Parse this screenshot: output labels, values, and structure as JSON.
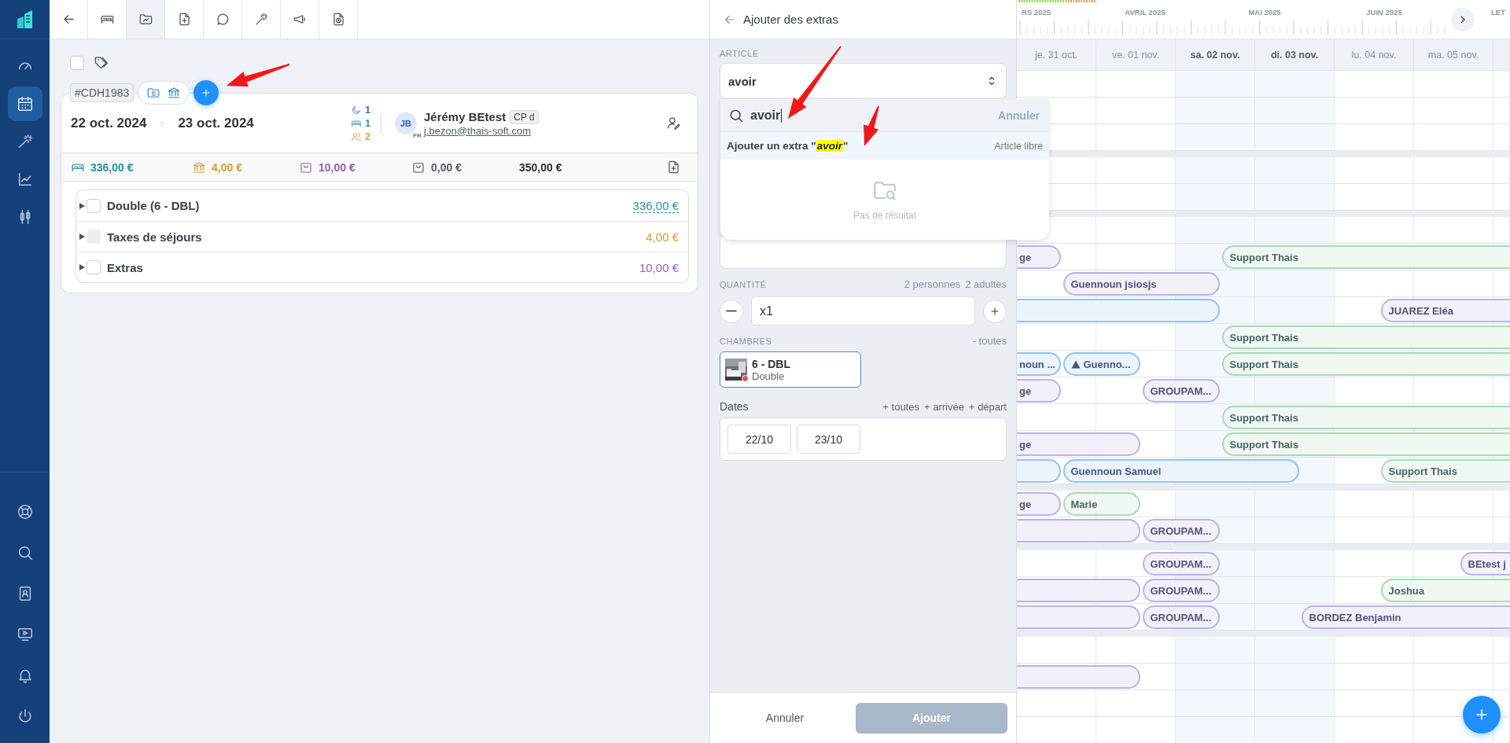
{
  "sidebar": {
    "top": [
      {
        "kind": "gauge",
        "selected": false
      },
      {
        "kind": "calendar",
        "selected": true
      },
      {
        "kind": "wand",
        "selected": false
      },
      {
        "kind": "chart",
        "selected": false
      },
      {
        "kind": "candles",
        "selected": false
      }
    ],
    "bottom": [
      {
        "kind": "lifebuoy",
        "selected": false
      },
      {
        "kind": "search",
        "selected": false
      },
      {
        "kind": "contacts",
        "selected": false
      },
      {
        "kind": "video",
        "selected": false
      },
      {
        "kind": "bell",
        "selected": false
      },
      {
        "kind": "power",
        "selected": false
      }
    ]
  },
  "toolbar": {
    "tabs": [
      {
        "kind": "back",
        "selected": false
      },
      {
        "kind": "bed",
        "selected": false
      },
      {
        "kind": "folder",
        "selected": true
      },
      {
        "kind": "file-plus",
        "selected": false
      },
      {
        "kind": "chat",
        "selected": false
      },
      {
        "kind": "wand",
        "selected": false
      },
      {
        "kind": "megaphone",
        "selected": false
      },
      {
        "kind": "file-clock",
        "selected": false
      }
    ]
  },
  "reservation": {
    "select_all": {
      "checked": false
    },
    "reference": "#CDH1983",
    "arrival": "22 oct. 2024",
    "departure": "23 oct. 2024",
    "counts": [
      {
        "kind": "nights",
        "value": "1"
      },
      {
        "kind": "rooms",
        "value": "1"
      },
      {
        "kind": "guests",
        "value": "2"
      }
    ],
    "guest": {
      "initials": "JB",
      "language": "FR",
      "name": "Jérémy BEtest",
      "badge": "CP d",
      "email": "j.bezon@thais-soft.com"
    },
    "totals": [
      {
        "kind": "room",
        "amount": "336,00 €"
      },
      {
        "kind": "tax",
        "amount": "4,00 €"
      },
      {
        "kind": "extras",
        "amount": "10,00 €"
      },
      {
        "kind": "paid",
        "amount": "0,00 €"
      },
      {
        "kind": "total",
        "amount": "350,00 €"
      }
    ],
    "lines": [
      {
        "kind": "room",
        "label": "Double (6 - DBL)",
        "amount": "336,00 €",
        "checked": false,
        "disabled": false
      },
      {
        "kind": "tax",
        "label": "Taxes de séjours",
        "amount": "4,00 €",
        "checked": false,
        "disabled": true
      },
      {
        "kind": "extras",
        "label": "Extras",
        "amount": "10,00 €",
        "checked": false,
        "disabled": false
      }
    ]
  },
  "extras_panel": {
    "title": "Ajouter des extras",
    "article_label": "ARTICLE",
    "article_value": "avoir",
    "dropdown": {
      "search_value": "avoir",
      "cancel": "Annuler",
      "option": {
        "before": "Ajouter un extra \"",
        "match": "avoir",
        "after": "\"",
        "hint": "Article libre",
        "selected": true
      },
      "empty": "Pas de résultat"
    },
    "quantity_label": "QUANTITÉ",
    "persons": "2 personnes",
    "adults": "2 adultes",
    "quantity": "x1",
    "rooms_label": "CHAMBRES",
    "rooms_all": "- toutes",
    "rooms": [
      {
        "number": "6 - DBL",
        "type": "Double",
        "selected": true,
        "color": "#e05555"
      }
    ],
    "dates_label": "Dates",
    "date_actions": [
      "+ toutes",
      "+ arrivée",
      "+ départ"
    ],
    "dates": [
      "22/10",
      "23/10"
    ],
    "cancel": "Annuler",
    "submit": {
      "label": "Ajouter",
      "disabled": true
    }
  },
  "calendar": {
    "months": [
      "RS 2025",
      "AVRIL 2025",
      "MAI 2025",
      "JUIN 2025",
      "LET"
    ],
    "days": [
      {
        "label": "je. 31 oct.",
        "weekend": false
      },
      {
        "label": "ve. 01 nov.",
        "weekend": false
      },
      {
        "label": "sa. 02 nov.",
        "weekend": true
      },
      {
        "label": "di. 03 nov.",
        "weekend": true
      },
      {
        "label": "lu. 04 nov.",
        "weekend": false
      },
      {
        "label": "ma. 05 nov.",
        "weekend": false
      }
    ],
    "rows": [
      {
        "kind": "row"
      },
      {
        "kind": "row"
      },
      {
        "kind": "row"
      },
      {
        "kind": "separator"
      },
      {
        "kind": "row"
      },
      {
        "kind": "row"
      },
      {
        "kind": "separator"
      },
      {
        "kind": "row"
      },
      {
        "kind": "row",
        "bars": [
          {
            "label": "ge",
            "color": "#b8b3e8",
            "warning": false
          },
          {
            "label": "Support Thais",
            "color": "#a6dcb2",
            "warning": false
          }
        ]
      },
      {
        "kind": "row",
        "bars": [
          {
            "label": "Guennoun jsiosjs",
            "color": "#b8b3e8",
            "warning": false
          }
        ]
      },
      {
        "kind": "row",
        "bars": [
          {
            "color": "#8fc3f5",
            "warning": false
          },
          {
            "label": "JUAREZ Eléa",
            "color": "#b8b3e8",
            "warning": false
          }
        ]
      },
      {
        "kind": "row",
        "bars": [
          {
            "label": "Support Thais",
            "color": "#a6dcb2",
            "warning": false
          }
        ]
      },
      {
        "kind": "row",
        "bars": [
          {
            "label": "noun ...",
            "color": "#8fc3f5",
            "warning": false
          },
          {
            "label": "Guenno...",
            "color": "#8fc3f5",
            "warning": true
          },
          {
            "label": "Support Thais",
            "color": "#a6dcb2",
            "warning": false
          }
        ]
      },
      {
        "kind": "row",
        "bars": [
          {
            "label": "ge",
            "color": "#b8b3e8",
            "warning": false
          },
          {
            "label": "GROUPAM...",
            "color": "#b8b3e8",
            "warning": false
          }
        ]
      },
      {
        "kind": "row",
        "bars": [
          {
            "label": "Support Thais",
            "color": "#a6dcb2",
            "warning": false
          }
        ]
      },
      {
        "kind": "row",
        "bars": [
          {
            "label": "ge",
            "color": "#b8b3e8",
            "warning": false
          },
          {
            "label": "Support Thais",
            "color": "#a6dcb2",
            "warning": false
          }
        ]
      },
      {
        "kind": "row",
        "bars": [
          {
            "color": "#8fc3f5",
            "warning": false
          },
          {
            "label": "Guennoun Samuel",
            "color": "#8fc3f5",
            "warning": false
          },
          {
            "label": "Support Thais",
            "color": "#a6dcb2",
            "warning": false
          }
        ]
      },
      {
        "kind": "separator"
      },
      {
        "kind": "row",
        "bars": [
          {
            "label": "ge",
            "color": "#b8b3e8",
            "warning": false
          },
          {
            "label": "Marie",
            "color": "#a6dcb2",
            "warning": false
          }
        ]
      },
      {
        "kind": "row",
        "bars": [
          {
            "color": "#b8b3e8",
            "warning": false
          },
          {
            "label": "GROUPAM...",
            "color": "#b8b3e8",
            "warning": false
          }
        ]
      },
      {
        "kind": "separator"
      },
      {
        "kind": "row",
        "bars": [
          {
            "label": "GROUPAM...",
            "color": "#b8b3e8",
            "warning": false
          },
          {
            "label": "BEtest j",
            "color": "#b8b3e8",
            "warning": false
          }
        ]
      },
      {
        "kind": "row",
        "bars": [
          {
            "color": "#b8b3e8",
            "warning": false
          },
          {
            "label": "GROUPAM...",
            "color": "#b8b3e8",
            "warning": false
          },
          {
            "label": "Joshua",
            "color": "#a6dcb2",
            "warning": false
          }
        ]
      },
      {
        "kind": "row",
        "bars": [
          {
            "color": "#b8b3e8",
            "warning": false
          },
          {
            "label": "GROUPAM...",
            "color": "#b8b3e8",
            "warning": false
          },
          {
            "label": "BORDEZ Benjamin",
            "color": "#b8b3e8",
            "warning": false
          }
        ]
      },
      {
        "kind": "separator"
      },
      {
        "kind": "row"
      },
      {
        "kind": "row",
        "bars": [
          {
            "color": "#b8b3e8",
            "warning": false
          }
        ]
      },
      {
        "kind": "row"
      },
      {
        "kind": "row"
      }
    ]
  }
}
